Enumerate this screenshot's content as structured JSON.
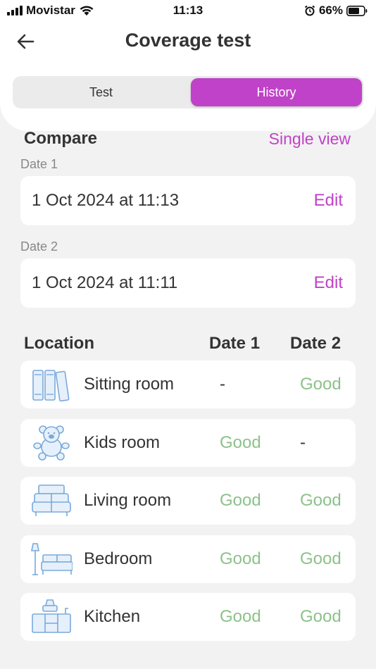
{
  "status": {
    "carrier": "Movistar",
    "time": "11:13",
    "battery": "66%"
  },
  "header": {
    "title": "Coverage test"
  },
  "tabs": {
    "test": "Test",
    "history": "History",
    "active": "History",
    "active_color": "#c042c8"
  },
  "compare": {
    "title": "Compare",
    "single_view": "Single view",
    "date1": {
      "label": "Date 1",
      "value": "1 Oct 2024 at 11:13",
      "edit": "Edit"
    },
    "date2": {
      "label": "Date 2",
      "value": "1 Oct 2024 at 11:11",
      "edit": "Edit"
    }
  },
  "table": {
    "headers": {
      "location": "Location",
      "date1": "Date 1",
      "date2": "Date 2"
    },
    "rows": [
      {
        "name": "Sitting room",
        "icon": "bookshelf-icon",
        "date1": "-",
        "date2": "Good"
      },
      {
        "name": "Kids room",
        "icon": "teddy-bear-icon",
        "date1": "Good",
        "date2": "-"
      },
      {
        "name": "Living room",
        "icon": "sofa-icon",
        "date1": "Good",
        "date2": "Good"
      },
      {
        "name": "Bedroom",
        "icon": "bed-icon",
        "date1": "Good",
        "date2": "Good"
      },
      {
        "name": "Kitchen",
        "icon": "kitchen-icon",
        "date1": "Good",
        "date2": "Good"
      }
    ],
    "good_color": "#8cc28a"
  }
}
